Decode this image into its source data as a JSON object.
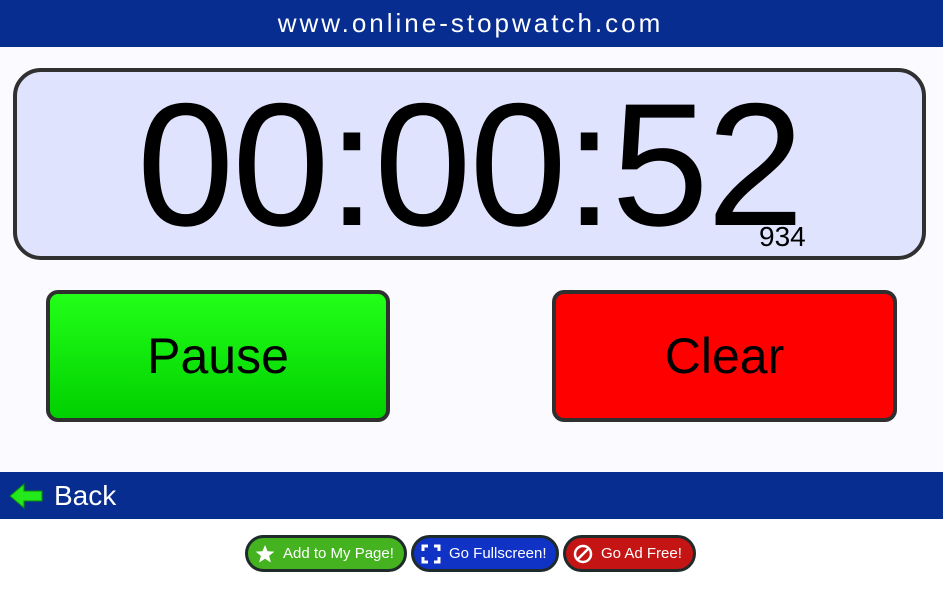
{
  "header": {
    "site_title": "www.online-stopwatch.com"
  },
  "stopwatch": {
    "time": "00:00:52",
    "milliseconds": "934"
  },
  "controls": {
    "pause_label": "Pause",
    "clear_label": "Clear"
  },
  "nav": {
    "back_label": "Back"
  },
  "actions": {
    "add_label": "Add to My Page!",
    "fullscreen_label": "Go Fullscreen!",
    "adfree_label": "Go Ad Free!"
  },
  "colors": {
    "header_bg": "#062d8f",
    "display_bg": "#e0e3fd",
    "pause_green": "#00e000",
    "clear_red": "#ff0000",
    "add_green": "#44b31f",
    "fullscreen_blue": "#1033c6",
    "adfree_red": "#c41414"
  },
  "icons": {
    "back": "left-arrow-icon",
    "add": "star-icon",
    "fullscreen": "fullscreen-icon",
    "adfree": "no-sign-icon"
  }
}
